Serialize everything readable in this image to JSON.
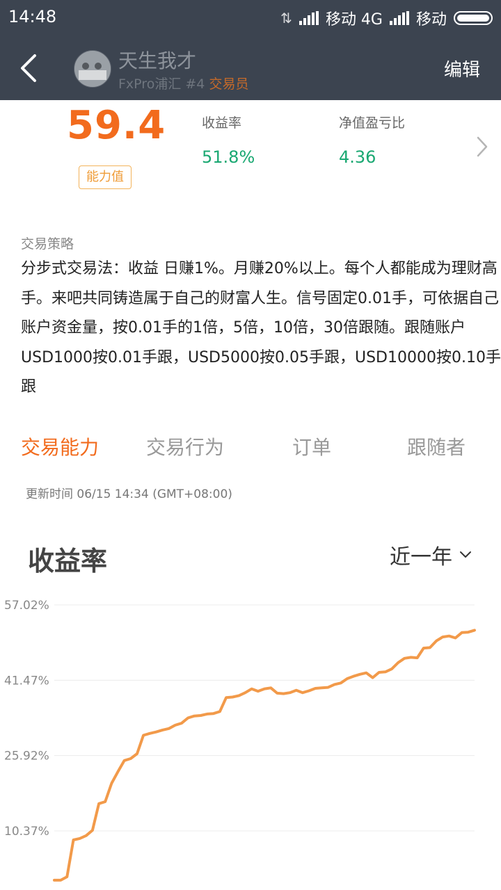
{
  "status_bar": {
    "time": "14:48",
    "carrier1": "移动 4G",
    "carrier2": "移动"
  },
  "header": {
    "back_icon": "back-arrow-icon",
    "user_name": "天生我才",
    "broker": "FxPro浦汇",
    "rank": "#4",
    "role": "交易员",
    "edit_label": "编辑"
  },
  "score": {
    "value": "59.4",
    "badge": "能力值"
  },
  "metrics": [
    {
      "label": "收益率",
      "value": "51.8%"
    },
    {
      "label": "净值盈亏比",
      "value": "4.36"
    }
  ],
  "strategy": {
    "title": "交易策略",
    "text": "分步式交易法：收益 日赚1%。月赚20%以上。每个人都能成为理财高手。来吧共同铸造属于自己的财富人生。信号固定0.01手，可依据自己账户资金量，按0.01手的1倍，5倍，10倍，30倍跟随。跟随账户USD1000按0.01手跟，USD5000按0.05手跟，USD10000按0.10手跟"
  },
  "tabs": [
    {
      "label": "交易能力",
      "active": true
    },
    {
      "label": "交易行为",
      "active": false
    },
    {
      "label": "订单",
      "active": false
    },
    {
      "label": "跟随者",
      "active": false
    }
  ],
  "update_time": "更新时间 06/15 14:34 (GMT+08:00)",
  "chart_section": {
    "title": "收益率",
    "range": "近一年"
  },
  "colors": {
    "accent": "#f26b1d",
    "positive": "#1aa872",
    "header_bg": "#3c4450",
    "line": "#f29a4a"
  },
  "chart_data": {
    "type": "line",
    "title": "",
    "xlabel": "",
    "ylabel": "",
    "y_ticks": [
      "57.02%",
      "41.47%",
      "25.92%",
      "10.37%"
    ],
    "y_tick_values": [
      57.02,
      41.47,
      25.92,
      10.37
    ],
    "ylim": [
      -0.5,
      57.02
    ],
    "grid": true,
    "x": [
      0,
      1,
      2,
      3,
      4,
      5,
      6,
      7,
      8,
      9,
      10,
      11,
      12,
      13,
      14,
      15,
      16,
      17,
      18,
      19,
      20,
      21,
      22,
      23,
      24,
      25,
      26,
      27,
      28,
      29,
      30,
      31,
      32,
      33,
      34,
      35,
      36,
      37,
      38,
      39,
      40,
      41,
      42,
      43,
      44,
      45,
      46,
      47,
      48,
      49,
      50,
      51,
      52,
      53,
      54,
      55,
      56,
      57,
      58,
      59,
      60,
      61,
      62,
      63,
      64,
      65,
      66,
      67,
      68,
      69,
      70,
      71,
      72,
      73,
      74,
      75,
      76,
      77,
      78,
      79,
      80,
      81,
      82,
      83,
      84,
      85,
      86,
      87,
      88,
      89,
      90,
      91,
      92,
      93,
      94,
      95,
      96,
      97,
      98,
      99
    ],
    "series": [
      {
        "values": [
          0.2,
          0.2,
          0.9,
          8.5,
          8.8,
          9.4,
          10.5,
          16.0,
          16.4,
          20.2,
          22.6,
          24.9,
          25.3,
          26.3,
          30.1,
          30.5,
          30.8,
          31.2,
          31.5,
          32.2,
          32.6,
          33.7,
          34.1,
          34.2,
          34.5,
          34.6,
          35.0,
          37.9,
          38.0,
          38.3,
          38.9,
          39.7,
          39.2,
          39.7,
          39.9,
          38.8,
          38.7,
          38.9,
          39.4,
          38.9,
          39.3,
          39.8,
          39.9,
          40.0,
          40.6,
          40.9,
          41.8,
          42.3,
          42.7,
          43.0,
          42.0,
          43.1,
          43.2,
          43.8,
          45.1,
          46.0,
          46.2,
          46.1,
          48.1,
          48.2,
          49.6,
          50.4,
          50.6,
          50.2,
          51.3,
          51.4,
          51.8
        ],
        "x_index_note_removed": null
      }
    ]
  }
}
